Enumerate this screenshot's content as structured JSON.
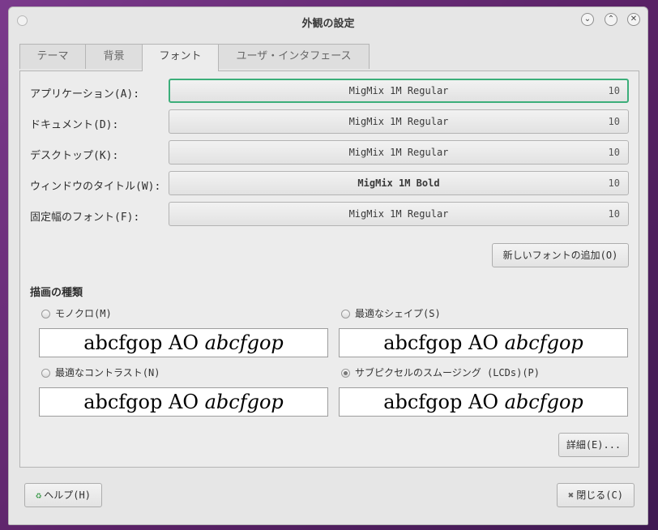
{
  "window": {
    "title": "外観の設定"
  },
  "tabs": [
    {
      "label": "テーマ"
    },
    {
      "label": "背景"
    },
    {
      "label": "フォント"
    },
    {
      "label": "ユーザ・インタフェース"
    }
  ],
  "fonts": [
    {
      "label": "アプリケーション(A):",
      "name": "MigMix 1M Regular",
      "size": "10"
    },
    {
      "label": "ドキュメント(D):",
      "name": "MigMix 1M Regular",
      "size": "10"
    },
    {
      "label": "デスクトップ(K):",
      "name": "MigMix 1M Regular",
      "size": "10"
    },
    {
      "label": "ウィンドウのタイトル(W):",
      "name": "MigMix 1M Bold",
      "size": "10"
    },
    {
      "label": "固定幅のフォント(F):",
      "name": "MigMix 1M Regular",
      "size": "10"
    }
  ],
  "add_font_label": "新しいフォントの追加(O)",
  "rendering": {
    "title": "描画の種類",
    "options": [
      {
        "label": "モノクロ(M)",
        "preview_regular": "abcfgop AO ",
        "preview_italic": "abcfgop"
      },
      {
        "label": "最適なシェイプ(S)",
        "preview_regular": "abcfgop AO ",
        "preview_italic": "abcfgop"
      },
      {
        "label": "最適なコントラスト(N)",
        "preview_regular": "abcfgop AO ",
        "preview_italic": "abcfgop"
      },
      {
        "label": "サブピクセルのスムージング (LCDs)(P)",
        "preview_regular": "abcfgop AO ",
        "preview_italic": "abcfgop"
      }
    ],
    "selected": "サブピクセルのスムージング (LCDs)(P)"
  },
  "details_label": "詳細(E)...",
  "help_label": "ヘルプ(H)",
  "close_label": "閉じる(C)",
  "colors": {
    "focus": "#3cae7a",
    "desktop": "#5a2266"
  },
  "icons": {
    "help": "lifebuoy-icon",
    "close": "close-x-icon",
    "minimize": "chevron-down-icon",
    "maximize": "chevron-up-icon",
    "window_close": "close-icon"
  }
}
